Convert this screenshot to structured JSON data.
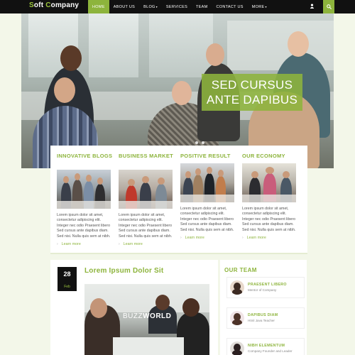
{
  "brand": {
    "part1": "S",
    "part2": "oft ",
    "part3": "C",
    "part4": "ompany"
  },
  "nav": {
    "items": [
      {
        "label": "HOME",
        "active": true,
        "dropdown": false
      },
      {
        "label": "ABOUT US",
        "active": false,
        "dropdown": false
      },
      {
        "label": "BLOG",
        "active": false,
        "dropdown": true
      },
      {
        "label": "SERVICES",
        "active": false,
        "dropdown": false
      },
      {
        "label": "TEAM",
        "active": false,
        "dropdown": false
      },
      {
        "label": "CONTACT US",
        "active": false,
        "dropdown": false
      },
      {
        "label": "MORE",
        "active": false,
        "dropdown": true
      }
    ],
    "user_icon": "user-icon",
    "search_icon": "search-icon"
  },
  "hero": {
    "line1": "SED CURSUS",
    "line2": "ANTE DAPIBUS"
  },
  "features": [
    {
      "title": "INNOVATIVE BLOGS",
      "text": "Lorem ipsum dolor sit amet, consectetur adipiscing elit. Integer nec odio Praesent libero Sed cursus ante dapibus diam. Sed nisi. Nulla quis sem at nibh.",
      "more": "Learn more"
    },
    {
      "title": "BUSINESS MARKET",
      "text": "Lorem ipsum dolor sit amet, consectetur adipiscing elit. Integer nec odio Praesent libero Sed cursus ante dapibus diam. Sed nisi. Nulla quis sem at nibh.",
      "more": "Learn more"
    },
    {
      "title": "POSITIVE RESULT",
      "text": "Lorem ipsum dolor sit amet, consectetur adipiscing elit. Integer nec odio Praesent libero Sed cursus ante dapibus diam. Sed nisi. Nulla quis sem at nibh.",
      "more": "Learn more"
    },
    {
      "title": "OUR ECONOMY",
      "text": "Lorem ipsum dolor sit amet, consectetur adipiscing elit. Integer nec odio Praesent libero Sed cursus ante dapibus diam. Sed nisi. Nulla quis sem at nibh.",
      "more": "Learn more"
    }
  ],
  "post": {
    "day": "28",
    "month": "Feb",
    "title": "Lorem Ipsum Dolor Sit",
    "image_text_1": "BUZZ",
    "image_text_2": "WORLD"
  },
  "team": {
    "heading": "OUR TEAM",
    "members": [
      {
        "name": "PRAESENT LIBERO",
        "role": "Mentor of Company"
      },
      {
        "name": "DAPIBUS DIAM",
        "role": "Html Java Teacher"
      },
      {
        "name": "NIBH ELEMENTUM",
        "role": "Company Founder and Leader"
      }
    ]
  },
  "colors": {
    "accent": "#8db43c",
    "nav_bg": "#111111",
    "page_bg": "#f3f7e9"
  }
}
